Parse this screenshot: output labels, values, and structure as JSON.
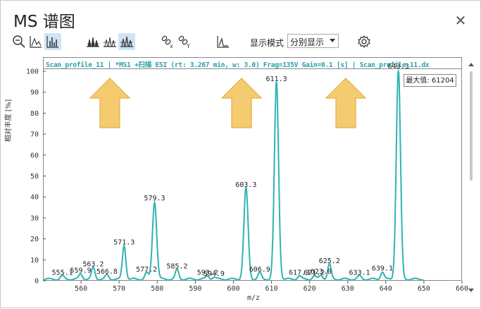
{
  "window": {
    "title": "MS 谱图",
    "close_glyph": "✕"
  },
  "toolbar": {
    "icons": [
      "zoom-out-icon",
      "peak-label-icon",
      "bar-chart-icon",
      "overlay-spectra-icon",
      "stacked-spectra-icon",
      "separate-spectra-icon",
      "link-x-icon",
      "link-y-icon",
      "spectrum-shape-icon",
      "settings-gear-icon"
    ],
    "display_mode_label": "显示模式",
    "display_mode_value": "分别显示"
  },
  "spectrum": {
    "scan_label": "Scan_profile_11 | *MS1 +扫描 ESI (rt: 3.267 min, w: 3.0) Frag=135V Gain=0.1 [s] | Scan_profile_11.dx",
    "max_label": "最大值: 61204",
    "line_color": "#2fb3b3",
    "arrow_color": "#f5c96a"
  },
  "chart_data": {
    "type": "line",
    "xlabel": "m/z",
    "ylabel": "相对丰度 [%]",
    "xlim": [
      550,
      660
    ],
    "ylim": [
      0,
      100
    ],
    "x_ticks": [
      560,
      570,
      580,
      590,
      600,
      610,
      620,
      630,
      640,
      650,
      660
    ],
    "y_ticks": [
      0,
      10,
      20,
      30,
      40,
      50,
      60,
      70,
      80,
      90,
      100
    ],
    "peaks": [
      {
        "mz": 555.1,
        "intensity": 1.5,
        "label": "555.1"
      },
      {
        "mz": 559.9,
        "intensity": 2.5,
        "label": "559.9"
      },
      {
        "mz": 563.2,
        "intensity": 5.5,
        "label": "563.2"
      },
      {
        "mz": 566.8,
        "intensity": 2.0,
        "label": "566.8"
      },
      {
        "mz": 571.3,
        "intensity": 16.0,
        "label": "571.3"
      },
      {
        "mz": 577.2,
        "intensity": 3.0,
        "label": "577.2"
      },
      {
        "mz": 579.3,
        "intensity": 37.0,
        "label": "579.3"
      },
      {
        "mz": 585.2,
        "intensity": 4.5,
        "label": "585.2"
      },
      {
        "mz": 593.2,
        "intensity": 1.5,
        "label": "593.2"
      },
      {
        "mz": 594.9,
        "intensity": 1.0,
        "label": "594.9"
      },
      {
        "mz": 603.3,
        "intensity": 43.5,
        "label": "603.3"
      },
      {
        "mz": 606.9,
        "intensity": 3.0,
        "label": "606.9"
      },
      {
        "mz": 611.3,
        "intensity": 94.0,
        "label": "611.3"
      },
      {
        "mz": 617.3,
        "intensity": 1.5,
        "label": "617.3"
      },
      {
        "mz": 621.2,
        "intensity": 1.5,
        "label": "621.2"
      },
      {
        "mz": 623.0,
        "intensity": 2.0,
        "label": "623.0"
      },
      {
        "mz": 625.2,
        "intensity": 7.0,
        "label": "625.2"
      },
      {
        "mz": 633.1,
        "intensity": 1.5,
        "label": "633.1"
      },
      {
        "mz": 639.1,
        "intensity": 3.5,
        "label": "639.1"
      },
      {
        "mz": 643.3,
        "intensity": 100.0,
        "label": "643.3"
      }
    ]
  }
}
